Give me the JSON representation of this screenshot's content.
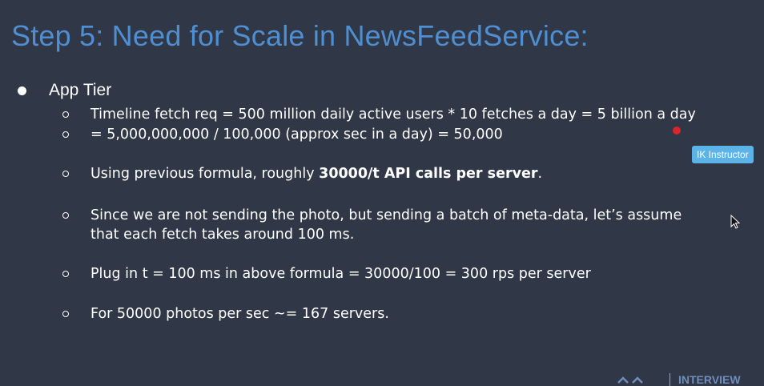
{
  "slide": {
    "title": "Step 5: Need for Scale in NewsFeedService:",
    "bullet": {
      "label": "App Tier",
      "items": [
        {
          "text": "Timeline fetch req = 500 million daily active users * 10 fetches a day = 5 billion a day"
        },
        {
          "text": "= 5,000,000,000  /  100,000 (approx sec in a day) = 50,000"
        },
        {
          "prefix": "Using previous formula, roughly ",
          "bold": "30000/t API calls per server",
          "suffix": "."
        },
        {
          "line1": "Since we are not sending the photo, but sending a batch of meta-data, let’s assume",
          "line2": "that each fetch takes around 100 ms."
        },
        {
          "text": "Plug in t = 100 ms in above formula = 30000/100 = 300 rps per server"
        },
        {
          "text": "For 50000 photos per sec ~= 167 servers."
        }
      ]
    }
  },
  "overlay": {
    "badge": "IK Instructor",
    "laser_color": "#d8262c"
  },
  "logo": {
    "text": "INTERVIEW",
    "icon": "interview-kickstart-logo-icon"
  },
  "colors": {
    "background": "#303746",
    "title": "#4f8fd1",
    "text": "#ffffff",
    "badge": "#5cb3e8"
  }
}
